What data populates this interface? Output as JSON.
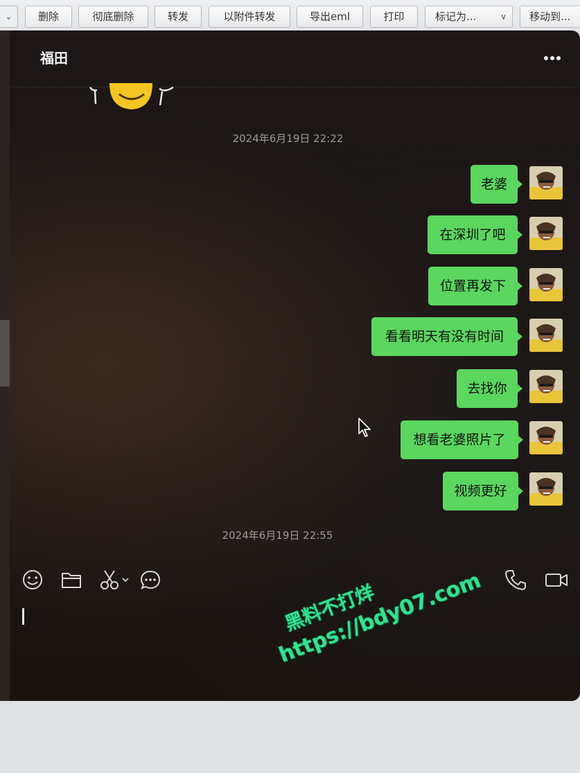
{
  "toolbar": {
    "buttons": [
      {
        "label": "删除"
      },
      {
        "label": "彻底删除"
      },
      {
        "label": "转发"
      },
      {
        "label": "以附件转发"
      },
      {
        "label": "导出eml"
      },
      {
        "label": "打印"
      },
      {
        "label": "标记为..."
      },
      {
        "label": "移动到..."
      }
    ]
  },
  "chat": {
    "title": "福田",
    "timestamps": [
      "2024年6月19日 22:22",
      "2024年6月19日 22:55"
    ],
    "messages": [
      {
        "text": "老婆"
      },
      {
        "text": "在深圳了吧"
      },
      {
        "text": "位置再发下"
      },
      {
        "text": "看看明天有没有时间"
      },
      {
        "text": "去找你"
      },
      {
        "text": "想看老婆照片了"
      },
      {
        "text": "视频更好"
      }
    ],
    "bubble_color": "#5bd65f",
    "background_color": "#1b1512"
  },
  "icons": {
    "header": [
      "more-icon"
    ],
    "input_tools": [
      "emoji-icon",
      "folder-icon",
      "scissors-icon",
      "chat-bubble-icon"
    ],
    "calls": [
      "phone-icon",
      "video-icon"
    ]
  },
  "watermark": {
    "line1": "黑料不打烊",
    "line2": "https://bdy07.com",
    "color": "#35e08f"
  }
}
